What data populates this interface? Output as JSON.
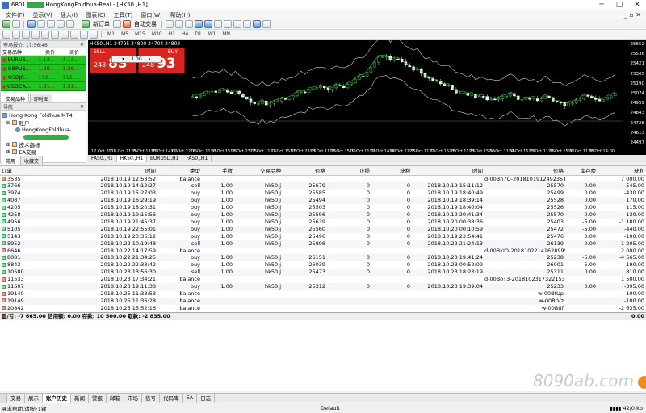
{
  "window": {
    "title": "HongKongFoldhua-Real - [HK50.,H1]",
    "account_prefix": "6801"
  },
  "menu": [
    "文件(F)",
    "显示(V)",
    "插入(I)",
    "图表(C)",
    "工具(T)",
    "窗口(W)",
    "帮助(H)"
  ],
  "toolbar": {
    "new_order": "新订单",
    "auto_trading": "自动交易"
  },
  "timeframes": [
    "M1",
    "M5",
    "M15",
    "M30",
    "H1",
    "H4",
    "D1",
    "W1",
    "MN"
  ],
  "market_watch": {
    "header": "市场报价: 17:56:46",
    "cols": [
      "交易品种",
      "卖价",
      "买价"
    ],
    "rows": [
      {
        "sym": "EURUS...",
        "bid": "1.13...",
        "ask": "1.13..."
      },
      {
        "sym": "GBPUS...",
        "bid": "1.28...",
        "ask": "1.28..."
      },
      {
        "sym": "USDJP...",
        "bid": "112....",
        "ask": "112...."
      },
      {
        "sym": "USDCA...",
        "bid": "1.31...",
        "ask": "1.31..."
      }
    ],
    "tabs": [
      "交易品种",
      "即时图"
    ]
  },
  "navigator": {
    "header": "导航",
    "root": "Hong Kong Foldhua MT4",
    "accounts": "账户",
    "account": "HongKongFoldhua-",
    "indicators": "技术指标",
    "ea": "EA交易",
    "tabs": [
      "常用",
      "收藏夹"
    ]
  },
  "chart": {
    "title": "HK50.,H1  24795 24800 24704 24803",
    "sell_label": "SELL",
    "buy_label": "BUY",
    "volume": "1.00",
    "sell_small": "248",
    "sell_big": "83",
    "buy_small": "248",
    "buy_big": "93",
    "price_axis": [
      "25652",
      "25536",
      "25421",
      "25305",
      "25190",
      "25074",
      "24959",
      "24843",
      "24728",
      "24613",
      "24497"
    ],
    "time_axis": [
      "12 Oct 2018",
      "12 Oct 21:15",
      "15 Oct 11:15",
      "15 Oct 14:00",
      "15 Oct 22:15",
      "16 Oct 11:15",
      "16 Oct 15:15",
      "16 Oct 23:15",
      "17 Oct 11:15",
      "17 Oct 15:15",
      "17 Oct 23:15",
      "18 Oct 11:15",
      "18 Oct 15:15",
      "19 Oct 11:15",
      "19 Oct 14:00",
      "19 Oct 22:15",
      "22 Oct 11:15",
      "22 Oct 15:15",
      "23 Oct 11:15",
      "23 Oct 15:15",
      "24 Oct 11:15",
      "24 Oct 15:15",
      "25 Oct 11:15",
      "25 Oct 15:15",
      "26 Oct 11:15",
      "26 Oct 14:00"
    ]
  },
  "chart_tabs": [
    "FA50.,H1",
    "HK50.,H1",
    "EURUSD,H1",
    "FA50.,H1"
  ],
  "orders": {
    "columns": [
      "订单",
      "时间",
      "类型",
      "手数",
      "交易品种",
      "价格",
      "止损",
      "获利",
      "时间",
      "价格",
      "库存费",
      "获利"
    ],
    "rows": [
      [
        "3535",
        "2018.10.19 12:53:52",
        "balance",
        "",
        "",
        "",
        "",
        "",
        "",
        "d-00Bh7Q-20181019124923519852",
        "",
        "7 000.00"
      ],
      [
        "3766",
        "2018.10.19 14:12:27",
        "sell",
        "1.00",
        "hk50.j",
        "25679",
        "0",
        "0",
        "2018.10.19 15:11:12",
        "25570",
        "0.00",
        "545.00"
      ],
      [
        "3974",
        "2018.10.19 15:27:03",
        "buy",
        "1.00",
        "hk50.j",
        "25585",
        "0",
        "0",
        "2018.10.19 18:40:49",
        "25499",
        "0.00",
        "-430.00"
      ],
      [
        "4087",
        "2018.10.19 16:29:19",
        "buy",
        "1.00",
        "hk50.j",
        "25494",
        "0",
        "0",
        "2018.10.19 18:39:14",
        "25528",
        "0.00",
        "170.00"
      ],
      [
        "4205",
        "2018.10.19 18:20:31",
        "buy",
        "1.00",
        "hk50.j",
        "25503",
        "0",
        "0",
        "2018.10.19 18:40:04",
        "25526",
        "0.00",
        "115.00"
      ],
      [
        "4258",
        "2018.10.19 19:15:56",
        "buy",
        "1.00",
        "hk50.j",
        "25596",
        "0",
        "0",
        "2018.10.19 20:41:34",
        "25570",
        "0.00",
        "-130.00"
      ],
      [
        "4956",
        "2018.10.19 21:45:37",
        "buy",
        "1.00",
        "hk50.j",
        "25639",
        "0",
        "0",
        "2018.10.20 00:38:36",
        "25403",
        "-5.00",
        "-1 180.00"
      ],
      [
        "5105",
        "2018.10.19 22:55:01",
        "buy",
        "1.00",
        "hk50.j",
        "25560",
        "0",
        "0",
        "2018.10.20 00:10:59",
        "25472",
        "-5.00",
        "-440.00"
      ],
      [
        "5143",
        "2018.10.19 23:35:12",
        "buy",
        "1.00",
        "hk50.j",
        "25496",
        "0",
        "0",
        "2018.10.19 23:54:41",
        "25476",
        "0.00",
        "-100.00"
      ],
      [
        "5952",
        "2018.10.22 10:19:48",
        "sell",
        "1.00",
        "hk50.j",
        "25898",
        "0",
        "0",
        "2018.10.22 21:24:13",
        "26139",
        "0.00",
        "-1 205.00"
      ],
      [
        "6646",
        "2018.10.22 14:17:59",
        "balance",
        "",
        "",
        "",
        "",
        "",
        "",
        "d-00BkIO-20181022141628995310",
        "",
        "2 000.00"
      ],
      [
        "8081",
        "2018.10.22 21:34:25",
        "buy",
        "1.00",
        "hk50.j",
        "26151",
        "0",
        "0",
        "2018.10.23 19:41:24",
        "25238",
        "-5.00",
        "-4 565.00"
      ],
      [
        "8843",
        "2018.10.22 22:38:42",
        "buy",
        "1.00",
        "hk50.j",
        "26039",
        "0",
        "0",
        "2018.10.23 00:52:09",
        "26001",
        "-5.00",
        "-190.00"
      ],
      [
        "10580",
        "2018.10.23 13:56:30",
        "sell",
        "1.00",
        "hk50.j",
        "25473",
        "0",
        "0",
        "2018.10.23 18:23:19",
        "25311",
        "0.00",
        "810.00"
      ],
      [
        "11533",
        "2018.10.23 17:34:21",
        "balance",
        "",
        "",
        "",
        "",
        "",
        "",
        "d-00BoT3-20181023173221539857",
        "",
        "1 500.00"
      ],
      [
        "11697",
        "2018.10.23 19:11:38",
        "buy",
        "1.00",
        "hk50.j",
        "25312",
        "0",
        "0",
        "2018.10.23 19:39:04",
        "25233",
        "0.00",
        "-395.00"
      ],
      [
        "19140",
        "2018.10.25 11:33:53",
        "balance",
        "",
        "",
        "",
        "",
        "",
        "",
        "w-00BtUp",
        "",
        "-100.00"
      ],
      [
        "19149",
        "2018.10.25 11:36:28",
        "balance",
        "",
        "",
        "",
        "",
        "",
        "",
        "w-00BtVz",
        "",
        "-100.00"
      ],
      [
        "20842",
        "2018.10.25 15:52:16",
        "balance",
        "",
        "",
        "",
        "",
        "",
        "",
        "w-00BtIf",
        "",
        "-2 635.00"
      ]
    ],
    "summary_label": "盈/亏: -7 665.00  信用额: 0.00  存款: 10 500.00  取款: -2 835.00",
    "summary_value": "0.00"
  },
  "bottom_tabs": [
    "交易",
    "展示",
    "账户历史",
    "新闻",
    "警报",
    "邮箱",
    "市场",
    "信号",
    "代码库",
    "EA",
    "日志"
  ],
  "bottom_active": 2,
  "status": {
    "help": "寻求帮助,请按F1键",
    "profile": "Default",
    "traffic": "42/0 kb"
  },
  "watermark": "8090ab.com"
}
